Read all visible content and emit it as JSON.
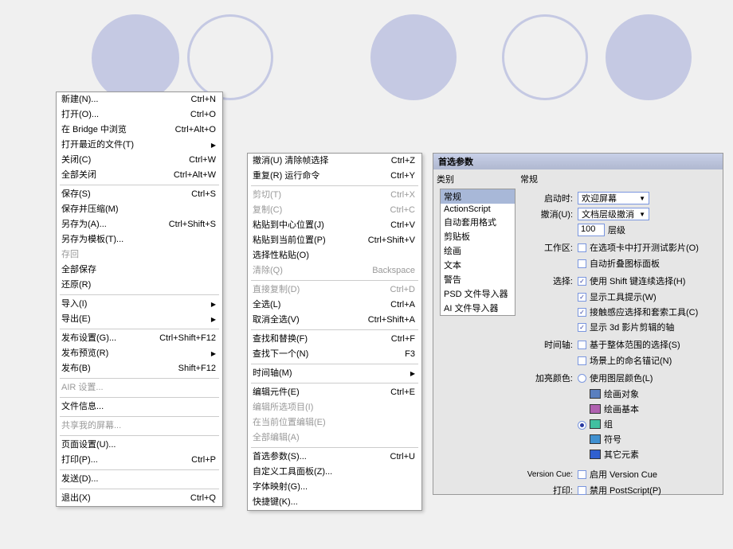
{
  "file_menu": [
    {
      "t": "item",
      "label": "新建(N)...",
      "shortcut": "Ctrl+N"
    },
    {
      "t": "item",
      "label": "打开(O)...",
      "shortcut": "Ctrl+O"
    },
    {
      "t": "item",
      "label": "在 Bridge 中浏览",
      "shortcut": "Ctrl+Alt+O"
    },
    {
      "t": "item",
      "label": "打开最近的文件(T)",
      "arrow": true
    },
    {
      "t": "item",
      "label": "关闭(C)",
      "shortcut": "Ctrl+W"
    },
    {
      "t": "item",
      "label": "全部关闭",
      "shortcut": "Ctrl+Alt+W"
    },
    {
      "t": "sep"
    },
    {
      "t": "item",
      "label": "保存(S)",
      "shortcut": "Ctrl+S"
    },
    {
      "t": "item",
      "label": "保存并压缩(M)"
    },
    {
      "t": "item",
      "label": "另存为(A)...",
      "shortcut": "Ctrl+Shift+S"
    },
    {
      "t": "item",
      "label": "另存为模板(T)..."
    },
    {
      "t": "item",
      "label": "存回",
      "disabled": true
    },
    {
      "t": "item",
      "label": "全部保存"
    },
    {
      "t": "item",
      "label": "还原(R)"
    },
    {
      "t": "sep"
    },
    {
      "t": "item",
      "label": "导入(I)",
      "arrow": true
    },
    {
      "t": "item",
      "label": "导出(E)",
      "arrow": true
    },
    {
      "t": "sep"
    },
    {
      "t": "item",
      "label": "发布设置(G)...",
      "shortcut": "Ctrl+Shift+F12"
    },
    {
      "t": "item",
      "label": "发布预览(R)",
      "arrow": true
    },
    {
      "t": "item",
      "label": "发布(B)",
      "shortcut": "Shift+F12"
    },
    {
      "t": "sep"
    },
    {
      "t": "item",
      "label": "AIR 设置...",
      "disabled": true
    },
    {
      "t": "sep"
    },
    {
      "t": "item",
      "label": "文件信息..."
    },
    {
      "t": "sep"
    },
    {
      "t": "item",
      "label": "共享我的屏幕...",
      "disabled": true
    },
    {
      "t": "sep"
    },
    {
      "t": "item",
      "label": "页面设置(U)..."
    },
    {
      "t": "item",
      "label": "打印(P)...",
      "shortcut": "Ctrl+P"
    },
    {
      "t": "sep"
    },
    {
      "t": "item",
      "label": "发送(D)..."
    },
    {
      "t": "sep"
    },
    {
      "t": "item",
      "label": "退出(X)",
      "shortcut": "Ctrl+Q"
    }
  ],
  "edit_menu": [
    {
      "t": "item",
      "label": "撤消(U) 清除帧选择",
      "shortcut": "Ctrl+Z"
    },
    {
      "t": "item",
      "label": "重复(R) 运行命令",
      "shortcut": "Ctrl+Y"
    },
    {
      "t": "sep"
    },
    {
      "t": "item",
      "label": "剪切(T)",
      "shortcut": "Ctrl+X",
      "disabled": true
    },
    {
      "t": "item",
      "label": "复制(C)",
      "shortcut": "Ctrl+C",
      "disabled": true
    },
    {
      "t": "item",
      "label": "粘贴到中心位置(J)",
      "shortcut": "Ctrl+V"
    },
    {
      "t": "item",
      "label": "粘贴到当前位置(P)",
      "shortcut": "Ctrl+Shift+V"
    },
    {
      "t": "item",
      "label": "选择性粘贴(O)"
    },
    {
      "t": "item",
      "label": "清除(Q)",
      "shortcut": "Backspace",
      "disabled": true
    },
    {
      "t": "sep"
    },
    {
      "t": "item",
      "label": "直接复制(D)",
      "shortcut": "Ctrl+D",
      "disabled": true
    },
    {
      "t": "item",
      "label": "全选(L)",
      "shortcut": "Ctrl+A"
    },
    {
      "t": "item",
      "label": "取消全选(V)",
      "shortcut": "Ctrl+Shift+A"
    },
    {
      "t": "sep"
    },
    {
      "t": "item",
      "label": "查找和替换(F)",
      "shortcut": "Ctrl+F"
    },
    {
      "t": "item",
      "label": "查找下一个(N)",
      "shortcut": "F3"
    },
    {
      "t": "sep"
    },
    {
      "t": "item",
      "label": "时间轴(M)",
      "arrow": true
    },
    {
      "t": "sep"
    },
    {
      "t": "item",
      "label": "编辑元件(E)",
      "shortcut": "Ctrl+E"
    },
    {
      "t": "item",
      "label": "编辑所选项目(I)",
      "disabled": true
    },
    {
      "t": "item",
      "label": "在当前位置编辑(E)",
      "disabled": true
    },
    {
      "t": "item",
      "label": "全部编辑(A)",
      "disabled": true
    },
    {
      "t": "sep"
    },
    {
      "t": "item",
      "label": "首选参数(S)...",
      "shortcut": "Ctrl+U"
    },
    {
      "t": "item",
      "label": "自定义工具面板(Z)..."
    },
    {
      "t": "item",
      "label": "字体映射(G)..."
    },
    {
      "t": "item",
      "label": "快捷键(K)..."
    }
  ],
  "panel": {
    "title": "首选参数",
    "cat_label": "类别",
    "settings_label": "常规",
    "categories": [
      "常规",
      "ActionScript",
      "自动套用格式",
      "剪贴板",
      "绘画",
      "文本",
      "警告",
      "PSD 文件导入器",
      "AI 文件导入器"
    ],
    "startup_label": "启动时:",
    "startup_value": "欢迎屏幕",
    "undo_label": "撤消(U):",
    "undo_value": "文档层级撤消",
    "undo_levels": "100",
    "undo_levels_label": "层级",
    "workspace_label": "工作区:",
    "workspace_opt1": "在选项卡中打开测试影片(O)",
    "workspace_opt2": "自动折叠图标面板",
    "select_label": "选择:",
    "select_opt1": "使用 Shift 键连续选择(H)",
    "select_opt2": "显示工具提示(W)",
    "select_opt3": "接触感应选择和套索工具(C)",
    "select_opt4": "显示 3d 影片剪辑的轴",
    "timeline_label": "时间轴:",
    "timeline_opt1": "基于整体范围的选择(S)",
    "timeline_opt2": "场景上的命名锚记(N)",
    "highlight_label": "加亮颜色:",
    "highlight_opt1": "使用图层颜色(L)",
    "highlight_items": [
      {
        "label": "绘画对象",
        "color": "#5a7fbf"
      },
      {
        "label": "绘画基本",
        "color": "#b060b0"
      },
      {
        "label": "组",
        "color": "#40c0a0"
      },
      {
        "label": "符号",
        "color": "#4090d0"
      },
      {
        "label": "其它元素",
        "color": "#3060d0"
      }
    ],
    "vcue_label": "Version Cue:",
    "vcue_opt": "启用 Version Cue",
    "print_label": "打印:",
    "print_opt": "禁用 PostScript(P)"
  }
}
